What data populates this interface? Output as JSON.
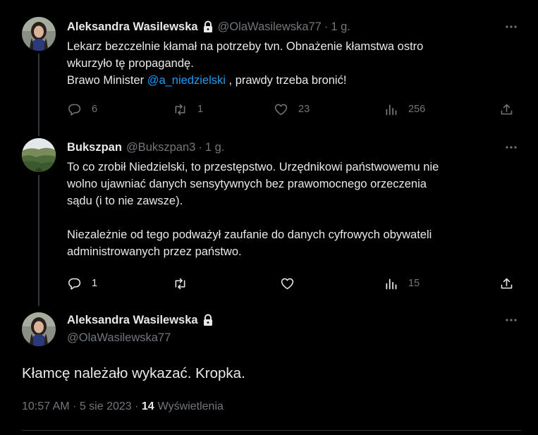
{
  "tweets": [
    {
      "name": "Aleksandra Wasilewska",
      "handle": "@OlaWasilewska77",
      "time": "1 g.",
      "separator": "·",
      "lines": [
        "Lekarz bezczelnie kłamał na potrzeby tvn. Obnażenie kłamstwa ostro",
        "wkurzyło tę propagandę."
      ],
      "line3_prefix": "Brawo Minister ",
      "mention": "@a_niedzielski",
      "line3_suffix": " , prawdy trzeba bronić!",
      "replies": "6",
      "retweets": "1",
      "likes": "23",
      "views": "256"
    },
    {
      "name": "Bukszpan",
      "handle": "@Bukszpan3",
      "time": "1 g.",
      "separator": "·",
      "paragraph1": [
        "To co zrobił Niedzielski, to przestępstwo. Urzędnikowi państwowemu nie",
        "wolno ujawniać danych sensytywnych bez prawomocnego orzeczenia",
        "sądu (i to nie zawsze)."
      ],
      "paragraph2": [
        "Niezależnie od tego podważył zaufanie do danych cyfrowych obywateli",
        "administrowanych przez państwo."
      ],
      "replies": "1",
      "retweets": "",
      "likes": "",
      "views": "15"
    }
  ],
  "focus": {
    "name": "Aleksandra Wasilewska",
    "handle": "@OlaWasilewska77",
    "text": "Kłamcę należało wykazać. Kropka.",
    "timestamp": "10:57 AM · 5 sie 2023 · ",
    "views_count": "14",
    "views_label": "Wyświetlenia"
  },
  "icons": {
    "lock": "lock-icon",
    "more": "more-icon",
    "reply": "reply-icon",
    "retweet": "retweet-icon",
    "like": "like-icon",
    "views": "views-icon",
    "share": "share-icon"
  },
  "colors": {
    "background": "#000000",
    "text": "#e7e9ea",
    "secondary": "#71767b",
    "mention": "#1d9bf0",
    "divider": "#2f3336"
  }
}
